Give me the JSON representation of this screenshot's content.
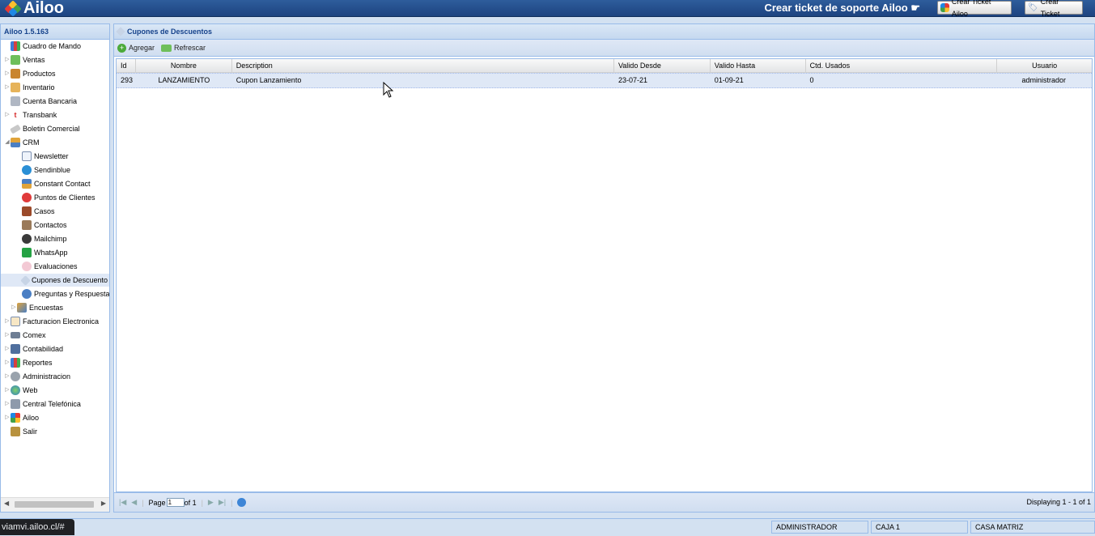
{
  "app": {
    "logo_text": "Ailoo",
    "version": "Ailoo 1.5.163"
  },
  "header": {
    "support_text": "Crear ticket de soporte Ailoo",
    "btn_ticket_ailoo": "Crear Ticket Ailoo",
    "btn_ticket": "Crear Ticket"
  },
  "sidebar": {
    "items": [
      {
        "label": "Cuadro de Mando",
        "icon": "chart-icon"
      },
      {
        "label": "Ventas",
        "icon": "money-icon"
      },
      {
        "label": "Productos",
        "icon": "box-icon"
      },
      {
        "label": "Inventario",
        "icon": "package-icon"
      },
      {
        "label": "Cuenta Bancaria",
        "icon": "bank-icon"
      },
      {
        "label": "Transbank",
        "icon": "transbank-icon"
      },
      {
        "label": "Boletin Comercial",
        "icon": "eraser-icon"
      },
      {
        "label": "CRM",
        "icon": "crm-icon"
      },
      {
        "label": "Newsletter",
        "icon": "mail-icon"
      },
      {
        "label": "Sendinblue",
        "icon": "sendinblue-icon"
      },
      {
        "label": "Constant Contact",
        "icon": "contact-icon"
      },
      {
        "label": "Puntos de Clientes",
        "icon": "points-icon"
      },
      {
        "label": "Casos",
        "icon": "briefcase-icon"
      },
      {
        "label": "Contactos",
        "icon": "contacts-icon"
      },
      {
        "label": "Mailchimp",
        "icon": "mailchimp-icon"
      },
      {
        "label": "WhatsApp",
        "icon": "whatsapp-icon"
      },
      {
        "label": "Evaluaciones",
        "icon": "evaluation-icon"
      },
      {
        "label": "Cupones de Descuento",
        "icon": "tag-icon"
      },
      {
        "label": "Preguntas y Respuestas",
        "icon": "question-icon"
      },
      {
        "label": "Encuestas",
        "icon": "survey-icon"
      },
      {
        "label": "Facturacion Electronica",
        "icon": "invoice-icon"
      },
      {
        "label": "Comex",
        "icon": "truck-icon"
      },
      {
        "label": "Contabilidad",
        "icon": "ledger-icon"
      },
      {
        "label": "Reportes",
        "icon": "report-icon"
      },
      {
        "label": "Administracion",
        "icon": "gear-icon"
      },
      {
        "label": "Web",
        "icon": "globe-icon"
      },
      {
        "label": "Central Telefónica",
        "icon": "phone-icon"
      },
      {
        "label": "Ailoo",
        "icon": "ailoo-icon"
      },
      {
        "label": "Salir",
        "icon": "exit-icon"
      }
    ]
  },
  "panel": {
    "title": "Cupones de Descuentos",
    "toolbar": {
      "add": "Agregar",
      "refresh": "Refrescar"
    },
    "columns": [
      "Id",
      "Nombre",
      "Description",
      "Valido Desde",
      "Valido Hasta",
      "Ctd. Usados",
      "Usuario"
    ],
    "rows": [
      {
        "id": "293",
        "nombre": "LANZAMIENTO",
        "description": "Cupon Lanzamiento",
        "desde": "23-07-21",
        "hasta": "01-09-21",
        "usados": "0",
        "usuario": "administrador"
      }
    ],
    "pager": {
      "page_label": "Page",
      "page_value": "1",
      "of_label": "of 1",
      "display": "Displaying 1 - 1 of 1"
    }
  },
  "status": {
    "user": "ADMINISTRADOR",
    "caja": "CAJA 1",
    "sucursal": "CASA MATRIZ"
  },
  "browser": {
    "url_tip": "viamvi.ailoo.cl/#"
  },
  "colors": {
    "header_bg": "#1d4380",
    "panel_head_text": "#15428b",
    "border": "#99bbe8",
    "selected_row": "#dfe8f6"
  }
}
